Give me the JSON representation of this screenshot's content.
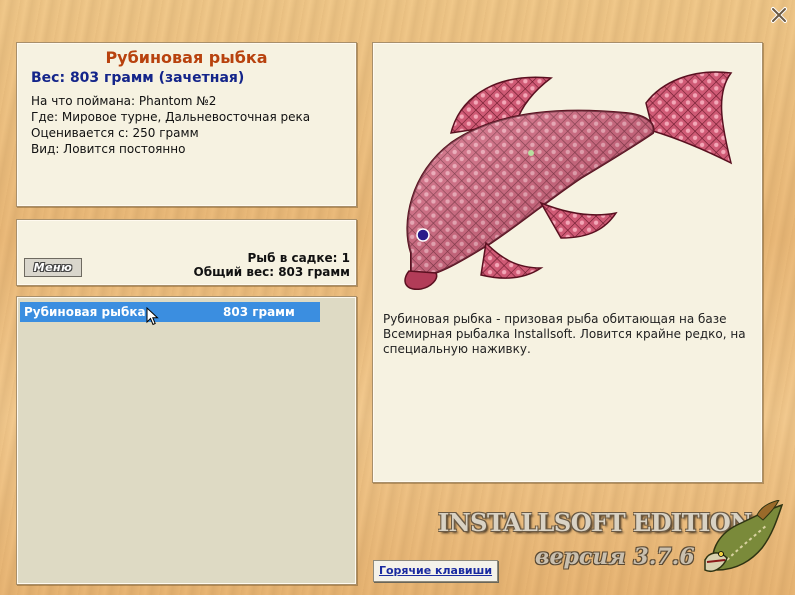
{
  "fish": {
    "name": "Рубиновая рыбка",
    "weight_line": "Вес: 803 грамм (зачетная)",
    "caught_on": "На что поймана: Phantom №2",
    "location": "Где: Мировое турне, Дальневосточная река",
    "rated_from": "Оценивается с: 250 грамм",
    "type": "Вид: Ловится постоянно"
  },
  "cage": {
    "menu_label": "Меню",
    "fish_count": "Рыб в садке: 1",
    "total_weight": "Общий вес: 803 грамм"
  },
  "list": {
    "items": [
      {
        "name": "Рубиновая рыбка",
        "weight": "803 грамм"
      }
    ]
  },
  "description": "Рубиновая рыбка - призовая рыба обитающая на базе Всемирная рыбалка Installsoft. Ловится крайне редко, на специальную наживку.",
  "footer": {
    "hotkeys_label": "Горячие клавиши",
    "brand": "INSTALLSOFT EDITION",
    "version": "версия 3.7.6"
  },
  "colors": {
    "title": "#b8420e",
    "weight": "#14258a",
    "selection": "#3b8ee0",
    "panel": "#f6f2e1"
  },
  "icons": [
    "close-icon",
    "cursor-icon",
    "ruby-fish-image",
    "pike-logo"
  ]
}
